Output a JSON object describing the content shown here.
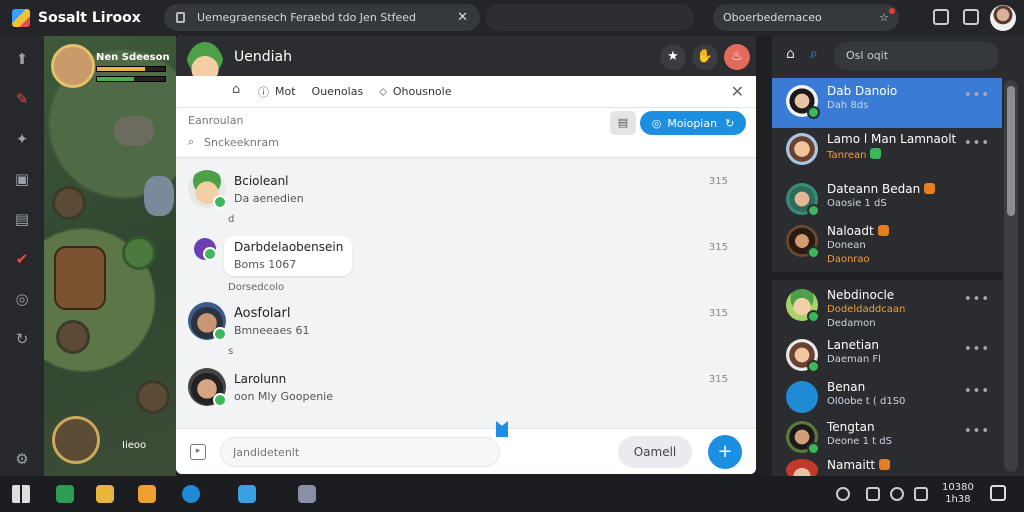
{
  "browser": {
    "title": "Sosalt Liroox",
    "url": "Uemegraensech Feraebd tdo Jen Stfeed",
    "search": "Oboerbedernaceo"
  },
  "game": {
    "player_name": "Nen Sdeeson",
    "level_label": "Iieoo",
    "health": 0.7,
    "energy": 0.55
  },
  "panel": {
    "title": "Uendiah",
    "tabs": [
      {
        "label": "Mot",
        "icon": "info-icon"
      },
      {
        "label": "Ouenolas",
        "icon": ""
      },
      {
        "label": "Ohousnole",
        "icon": "tag-icon"
      }
    ],
    "search_label": "Eanroulan",
    "search_placeholder": "Snckeeknram",
    "action_label": "Moiopian"
  },
  "messages": [
    {
      "name": "Bcioleanl",
      "sub": "Da aenedien",
      "time": "315",
      "extra": "d"
    },
    {
      "name": "Darbdelaobensein",
      "sub": "Boms 1067",
      "time": "315",
      "extra": "Dorsedcolo"
    },
    {
      "name": "Aosfolarl",
      "sub": "Bmneeaes 61",
      "time": "315",
      "extra": "s"
    },
    {
      "name": "Larolunn",
      "sub": "oon Mly Goopenie",
      "time": "315",
      "extra": ""
    }
  ],
  "composer": {
    "placeholder": "Jandidetenlt",
    "cancel_label": "Oamell",
    "send_label": "+"
  },
  "friends_panel": {
    "search_placeholder": "Osl oqit",
    "friends": [
      {
        "name": "Dab Danoio",
        "sub": "Dah 8ds",
        "sub2": "",
        "active": true
      },
      {
        "name": "Lamo l Man Lamnaolt",
        "sub": "Tanrean",
        "sub2": "",
        "active": false
      },
      {
        "name": "Dateann Bedan",
        "sub": "Oaosie 1 dS",
        "sub2": "",
        "active": false
      },
      {
        "name": "Naloadt",
        "sub": "Donean",
        "sub2": "Daonrao",
        "active": false
      },
      {
        "name": "Nebdinocle",
        "sub": "Dodeldaddcaan",
        "sub2": "Dedamon",
        "active": false
      },
      {
        "name": "Lanetian",
        "sub": "Daeman Fl",
        "sub2": "",
        "active": false
      },
      {
        "name": "Benan",
        "sub": "Ol0obe t ( d1S0",
        "sub2": "",
        "active": false
      },
      {
        "name": "Tengtan",
        "sub": "Deone 1 t dS",
        "sub2": "",
        "active": false
      },
      {
        "name": "Namaitt",
        "sub": "",
        "sub2": "",
        "active": false
      }
    ]
  },
  "taskbar": {
    "time": "10380",
    "date": "1h38"
  },
  "colors": {
    "accent": "#1d8fe1",
    "active_friend": "#3a7bd5",
    "status_online": "#3cb85a",
    "alert": "#e67e22"
  }
}
